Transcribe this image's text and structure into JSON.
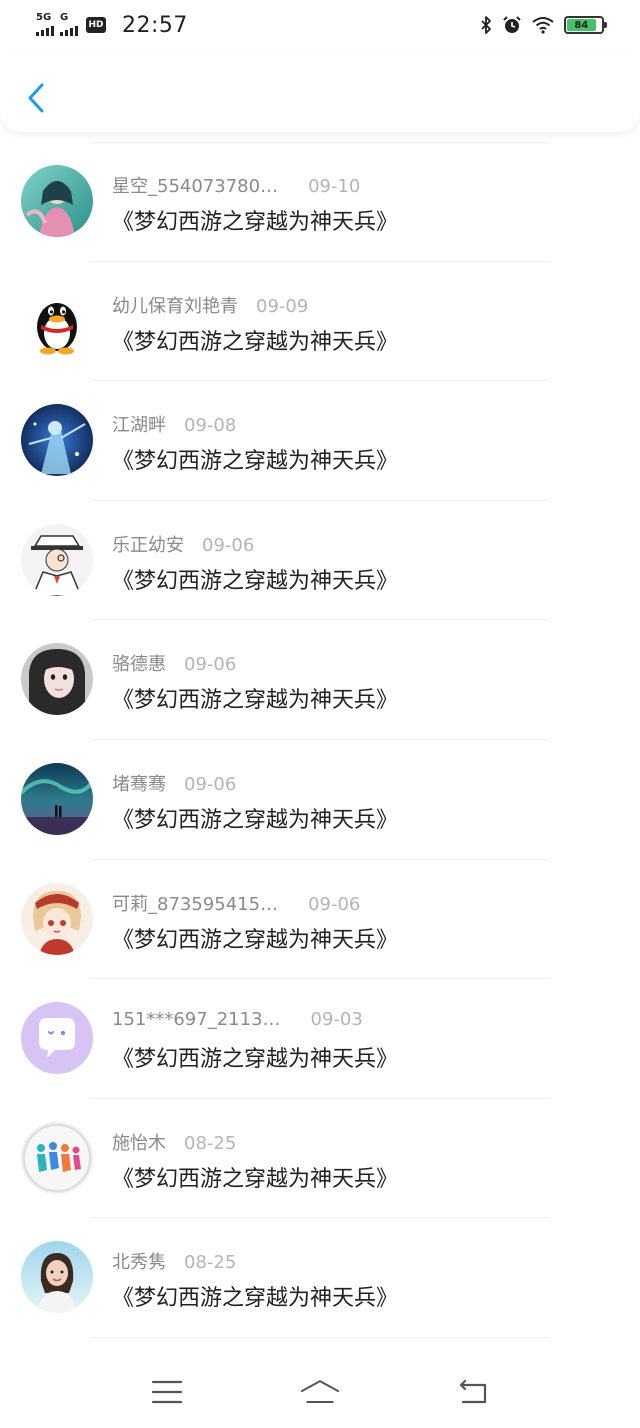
{
  "status_bar": {
    "network_1": "5G",
    "network_2": "G",
    "hd": "HD",
    "time": "22:57",
    "battery_level": "84",
    "icons": [
      "bluetooth-icon",
      "alarm-icon",
      "wifi-icon",
      "battery-icon"
    ]
  },
  "header": {
    "back_icon": "chevron-left-icon",
    "accent_color": "#1a9bf0"
  },
  "items": [
    {
      "name": "星空_554073780…",
      "date": "09-10",
      "title": "《梦幻西游之穿越为神天兵》",
      "avatar": "avatar-fantasy-girl"
    },
    {
      "name": "幼儿保育刘艳青",
      "date": "09-09",
      "title": "《梦幻西游之穿越为神天兵》",
      "avatar": "avatar-qq-penguin"
    },
    {
      "name": "江湖畔",
      "date": "09-08",
      "title": "《梦幻西游之穿越为神天兵》",
      "avatar": "avatar-blue-warrior"
    },
    {
      "name": "乐正幼安",
      "date": "09-06",
      "title": "《梦幻西游之穿越为神天兵》",
      "avatar": "avatar-kid-thief"
    },
    {
      "name": "骆德惠",
      "date": "09-06",
      "title": "《梦幻西游之穿越为神天兵》",
      "avatar": "avatar-girl-photo"
    },
    {
      "name": "堵骞骞",
      "date": "09-06",
      "title": "《梦幻西游之穿越为神天兵》",
      "avatar": "avatar-aurora"
    },
    {
      "name": "可莉_873595415…",
      "date": "09-06",
      "title": "《梦幻西游之穿越为神天兵》",
      "avatar": "avatar-klee"
    },
    {
      "name": "151***697_2113…",
      "date": "09-03",
      "title": "《梦幻西游之穿越为神天兵》",
      "avatar": "avatar-chat-bubble"
    },
    {
      "name": "施怡木",
      "date": "08-25",
      "title": "《梦幻西游之穿越为神天兵》",
      "avatar": "avatar-runners"
    },
    {
      "name": "北秀隽",
      "date": "08-25",
      "title": "《梦幻西游之穿越为神天兵》",
      "avatar": "avatar-beach-girl"
    }
  ],
  "nav": {
    "menu_icon": "menu-icon",
    "home_icon": "home-icon",
    "back_icon": "back-icon"
  }
}
